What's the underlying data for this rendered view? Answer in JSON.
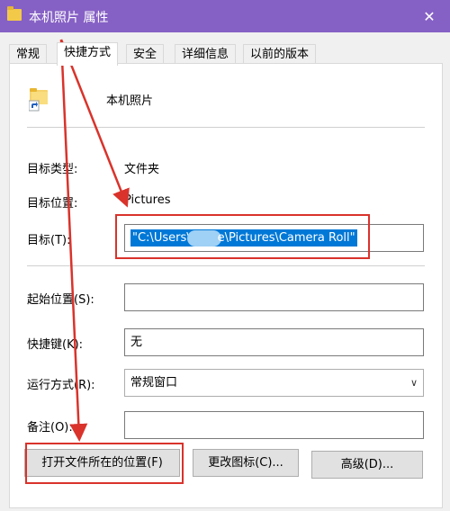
{
  "window": {
    "title": "本机照片 属性",
    "close_glyph": "✕",
    "accent": "#8661c5"
  },
  "tabs": [
    {
      "label": "常规",
      "active": false
    },
    {
      "label": "快捷方式",
      "active": true
    },
    {
      "label": "安全",
      "active": false
    },
    {
      "label": "详细信息",
      "active": false
    },
    {
      "label": "以前的版本",
      "active": false
    }
  ],
  "shortcut": {
    "name": "本机照片",
    "target_type_label": "目标类型:",
    "target_type_value": "文件夹",
    "target_location_label": "目标位置:",
    "target_location_value": "Pictures",
    "target_label": "目标(T):",
    "target_value_start": "\"C:\\Users\\",
    "target_value_end": "e\\Pictures\\Camera Roll\"",
    "start_in_label": "起始位置(S):",
    "start_in_value": "",
    "shortcut_key_label": "快捷键(K):",
    "shortcut_key_value": "无",
    "run_label": "运行方式(R):",
    "run_value": "常规窗口",
    "comment_label": "备注(O):",
    "comment_value": ""
  },
  "buttons": {
    "open_location": "打开文件所在的位置(F)",
    "change_icon": "更改图标(C)...",
    "advanced": "高级(D)..."
  },
  "annotation_color": "#d9332b",
  "icons": {
    "folder": "folder-icon",
    "shortcut_arrow": "shortcut-arrow-icon",
    "chevron": "chevron-down-icon"
  }
}
